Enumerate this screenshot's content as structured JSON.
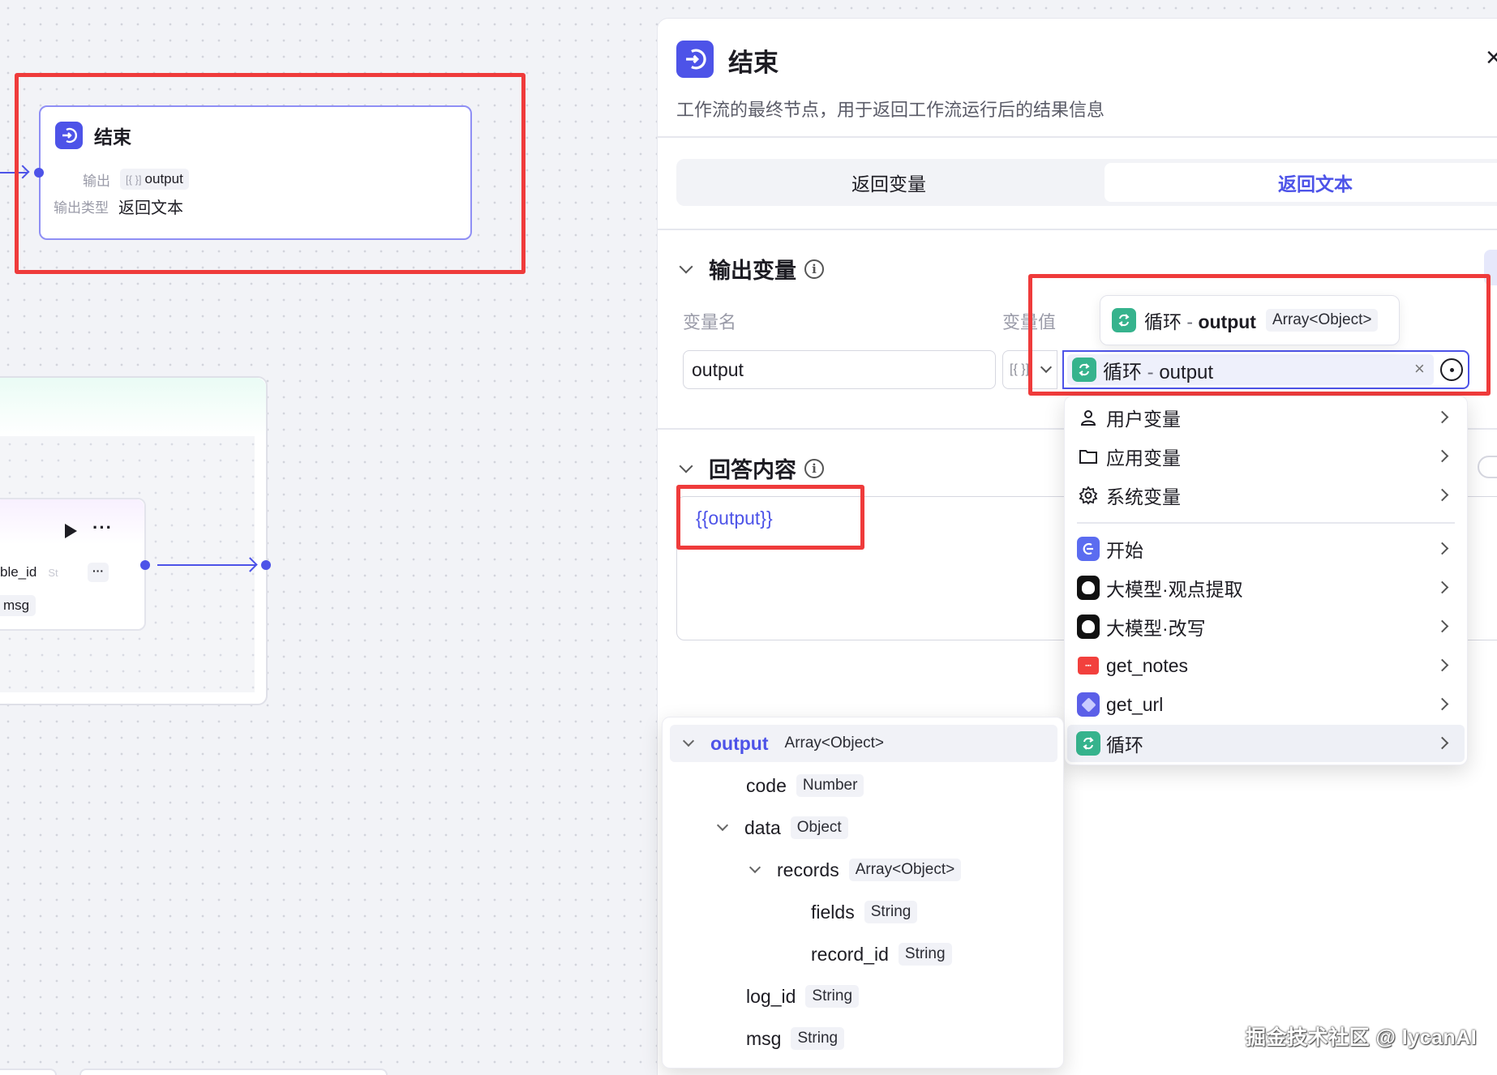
{
  "canvas": {
    "end_node": {
      "title": "结束",
      "output_label": "输出",
      "output_var": "output",
      "output_type_label": "输出类型",
      "output_type_value": "返回文本"
    },
    "inner_node": {
      "field1": "ble_id",
      "field1_type": "St",
      "field2": "msg",
      "more": "···"
    }
  },
  "panel": {
    "title": "结束",
    "description": "工作流的最终节点，用于返回工作流运行后的结果信息",
    "tabs": [
      {
        "label": "返回变量",
        "active": false
      },
      {
        "label": "返回文本",
        "active": true
      }
    ],
    "output_section": {
      "title": "输出变量",
      "col_name": "变量名",
      "col_value": "变量值",
      "name_value": "output",
      "type_glyph": "[{ }]",
      "ref_source": "循环",
      "ref_sep": " - ",
      "ref_var": "output"
    },
    "tooltip": {
      "source": "循环",
      "sep": " - ",
      "var": "output",
      "type": "Array<Object>"
    },
    "answer_section": {
      "title": "回答内容",
      "content": "{{output}}"
    }
  },
  "dropdown": {
    "items": [
      {
        "label": "用户变量",
        "icon": "user-icon"
      },
      {
        "label": "应用变量",
        "icon": "folder-icon"
      },
      {
        "label": "系统变量",
        "icon": "gear-icon"
      },
      {
        "label": "开始",
        "icon": "start-node-icon"
      },
      {
        "label": "大模型·观点提取",
        "icon": "llm-icon"
      },
      {
        "label": "大模型·改写",
        "icon": "llm-icon"
      },
      {
        "label": "get_notes",
        "icon": "notes-plugin-icon"
      },
      {
        "label": "get_url",
        "icon": "cube-plugin-icon"
      },
      {
        "label": "循环",
        "icon": "loop-icon",
        "active": true
      }
    ]
  },
  "tree": {
    "rows": [
      {
        "name": "output",
        "type": "Array<Object>",
        "depth": 0,
        "expandable": true,
        "selected": true
      },
      {
        "name": "code",
        "type": "Number",
        "depth": 1,
        "expandable": false
      },
      {
        "name": "data",
        "type": "Object",
        "depth": 1,
        "expandable": true
      },
      {
        "name": "records",
        "type": "Array<Object>",
        "depth": 2,
        "expandable": true
      },
      {
        "name": "fields",
        "type": "String",
        "depth": 3,
        "expandable": false
      },
      {
        "name": "record_id",
        "type": "String",
        "depth": 3,
        "expandable": false
      },
      {
        "name": "log_id",
        "type": "String",
        "depth": 1,
        "expandable": false
      },
      {
        "name": "msg",
        "type": "String",
        "depth": 1,
        "expandable": false
      }
    ]
  },
  "watermark": "掘金技术社区 @ lycanAI",
  "colors": {
    "accent": "#4d53e8",
    "loop_green": "#36b38d",
    "highlight_red": "#ef3b3b"
  }
}
